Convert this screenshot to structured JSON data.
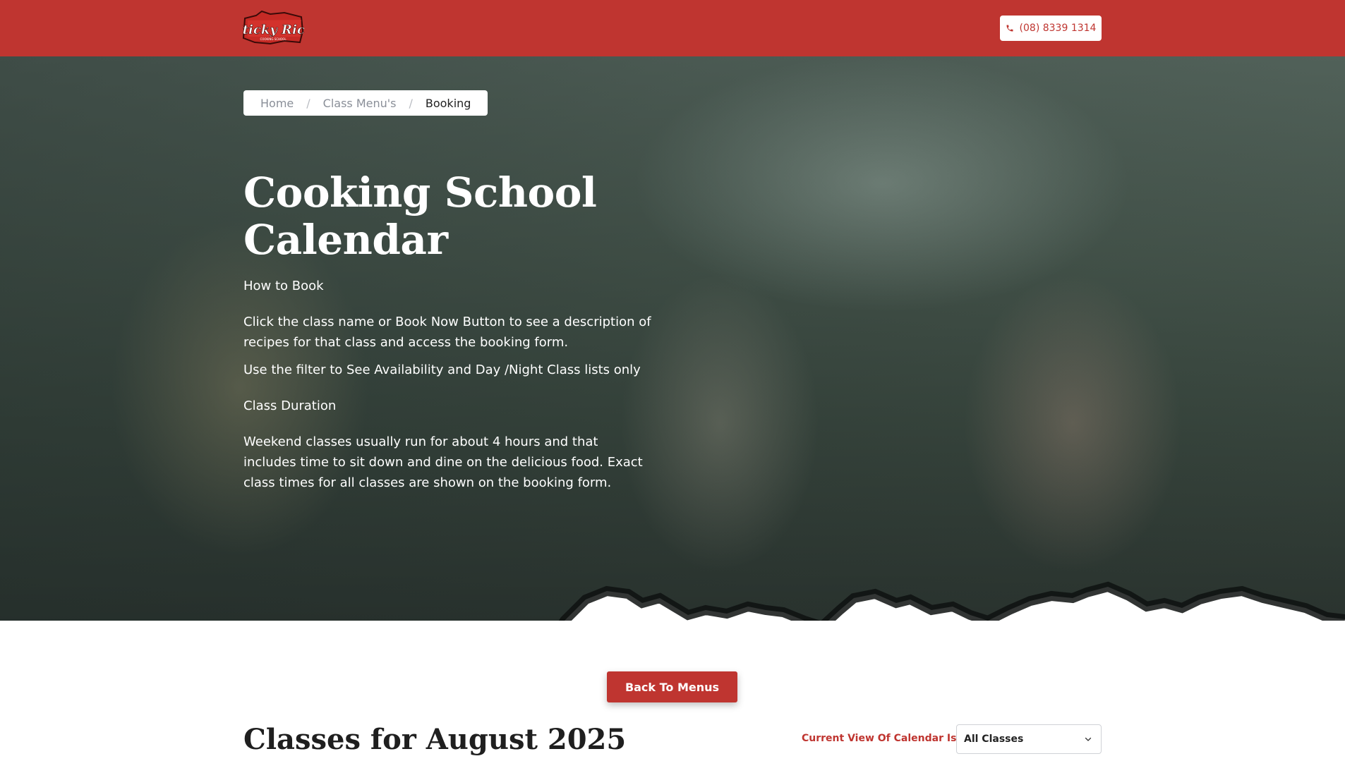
{
  "brand": {
    "logo_text": "Sticky Rice",
    "logo_subtext": "COOKING SCHOOL"
  },
  "header": {
    "phone": "(08) 8339 1314"
  },
  "breadcrumb": {
    "items": [
      "Home",
      "Class Menu's",
      "Booking"
    ],
    "separator": "/"
  },
  "hero": {
    "title": "Cooking School Calendar",
    "how_to_book_heading": "How to Book",
    "how_to_book_text": "Click the class name or Book Now Button to see a description of recipes for that class and access the booking form.",
    "filter_text": "Use the filter to See Availability and Day /Night Class lists only",
    "duration_heading": "Class Duration",
    "duration_text": "Weekend classes usually run for about 4 hours and that includes time to sit down and dine on the delicious food. Exact class times for all classes are shown on the booking form."
  },
  "actions": {
    "back_to_menus": "Back To Menus"
  },
  "calendar": {
    "month_title": "Classes for August 2025",
    "view_label": "Current View Of Calendar Is",
    "filter_selected": "All Classes"
  },
  "colors": {
    "brand_red": "#bf3530",
    "white": "#ffffff"
  },
  "icons": {
    "phone": "phone-icon",
    "dropdown": "chevron-down-icon"
  }
}
